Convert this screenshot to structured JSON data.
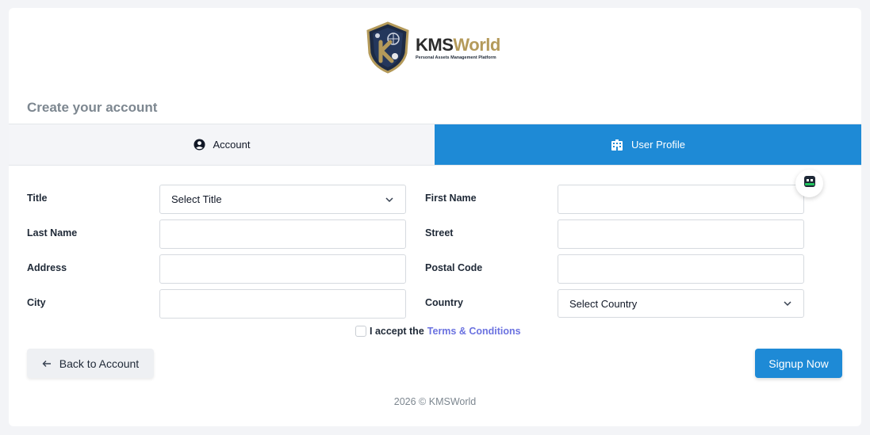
{
  "brand": {
    "name_part1": "KMS",
    "name_part2": "World",
    "tagline": "Personal Assets Management Platform"
  },
  "page": {
    "title": "Create your account"
  },
  "tabs": [
    {
      "label": "Account",
      "icon": "user-circle-icon",
      "active": false
    },
    {
      "label": "User Profile",
      "icon": "building-icon",
      "active": true
    }
  ],
  "form": {
    "title_label": "Title",
    "title_selected": "Select Title",
    "first_name_label": "First Name",
    "first_name_value": "",
    "last_name_label": "Last Name",
    "last_name_value": "",
    "street_label": "Street",
    "street_value": "",
    "address_label": "Address",
    "address_value": "",
    "postal_code_label": "Postal Code",
    "postal_code_value": "",
    "city_label": "City",
    "city_value": "",
    "country_label": "Country",
    "country_selected": "Select Country"
  },
  "terms": {
    "text": "I accept the",
    "link": "Terms & Conditions"
  },
  "buttons": {
    "back": "Back to Account",
    "signup": "Signup Now"
  },
  "footer": {
    "text": "2026 © KMSWorld"
  },
  "colors": {
    "primary": "#1e8ad6",
    "link": "#6b72e0",
    "gold": "#b49a5a"
  }
}
